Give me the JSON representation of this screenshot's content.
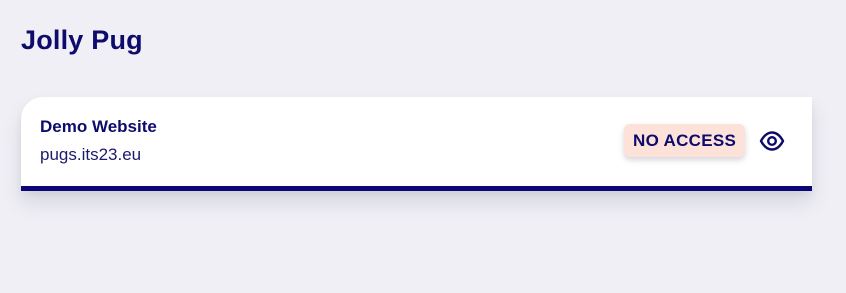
{
  "header": {
    "title": "Jolly Pug"
  },
  "sites": [
    {
      "name": "Demo Website",
      "url": "pugs.its23.eu",
      "status_badge": "NO ACCESS",
      "action_icon": "eye-icon"
    }
  ],
  "colors": {
    "accent": "#0b0673",
    "background": "#efeff5",
    "badge_background": "#fde2d9",
    "badge_text": "#0d0b6b"
  }
}
